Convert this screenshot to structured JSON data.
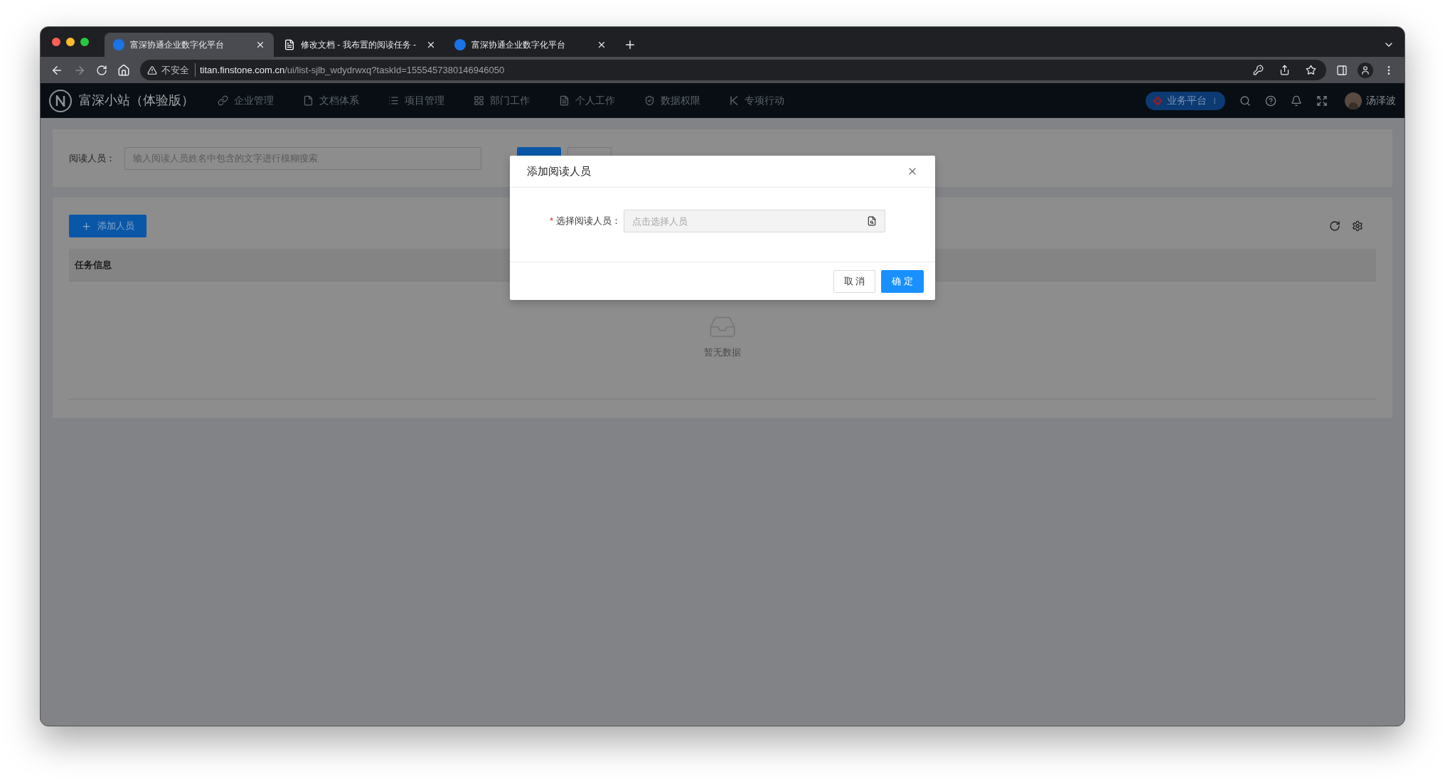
{
  "browser": {
    "tabs": [
      {
        "title": "富深协通企业数字化平台",
        "kind": "app",
        "selected": true
      },
      {
        "title": "修改文档 - 我布置的阅读任务 -",
        "kind": "document",
        "selected": false
      },
      {
        "title": "富深协通企业数字化平台",
        "kind": "app",
        "selected": false
      }
    ],
    "address": {
      "security": "不安全",
      "host": "titan.finstone.com.cn",
      "path": "/ui/list-sjlb_wdydrwxq?taskId=1555457380146946050"
    }
  },
  "app": {
    "title": "富深小站（体验版）",
    "nav": [
      {
        "label": "企业管理"
      },
      {
        "label": "文档体系"
      },
      {
        "label": "项目管理"
      },
      {
        "label": "部门工作"
      },
      {
        "label": "个人工作"
      },
      {
        "label": "数据权限"
      },
      {
        "label": "专项行动"
      }
    ],
    "platform": "业务平台",
    "user": "汤泽波"
  },
  "filter": {
    "label": "阅读人员：",
    "placeholder": "输入阅读人员姓名中包含的文字进行模糊搜索"
  },
  "toolbar": {
    "add_button": "添加人员"
  },
  "table": {
    "columns": [
      "任务信息"
    ],
    "empty": "暂无数据"
  },
  "dialog": {
    "title": "添加阅读人员",
    "field": {
      "required_mark": "*",
      "label": "选择阅读人员：",
      "placeholder": "点击选择人员"
    },
    "buttons": [
      {
        "label": "取 消",
        "kind": "default"
      },
      {
        "label": "确 定",
        "kind": "primary"
      }
    ]
  }
}
